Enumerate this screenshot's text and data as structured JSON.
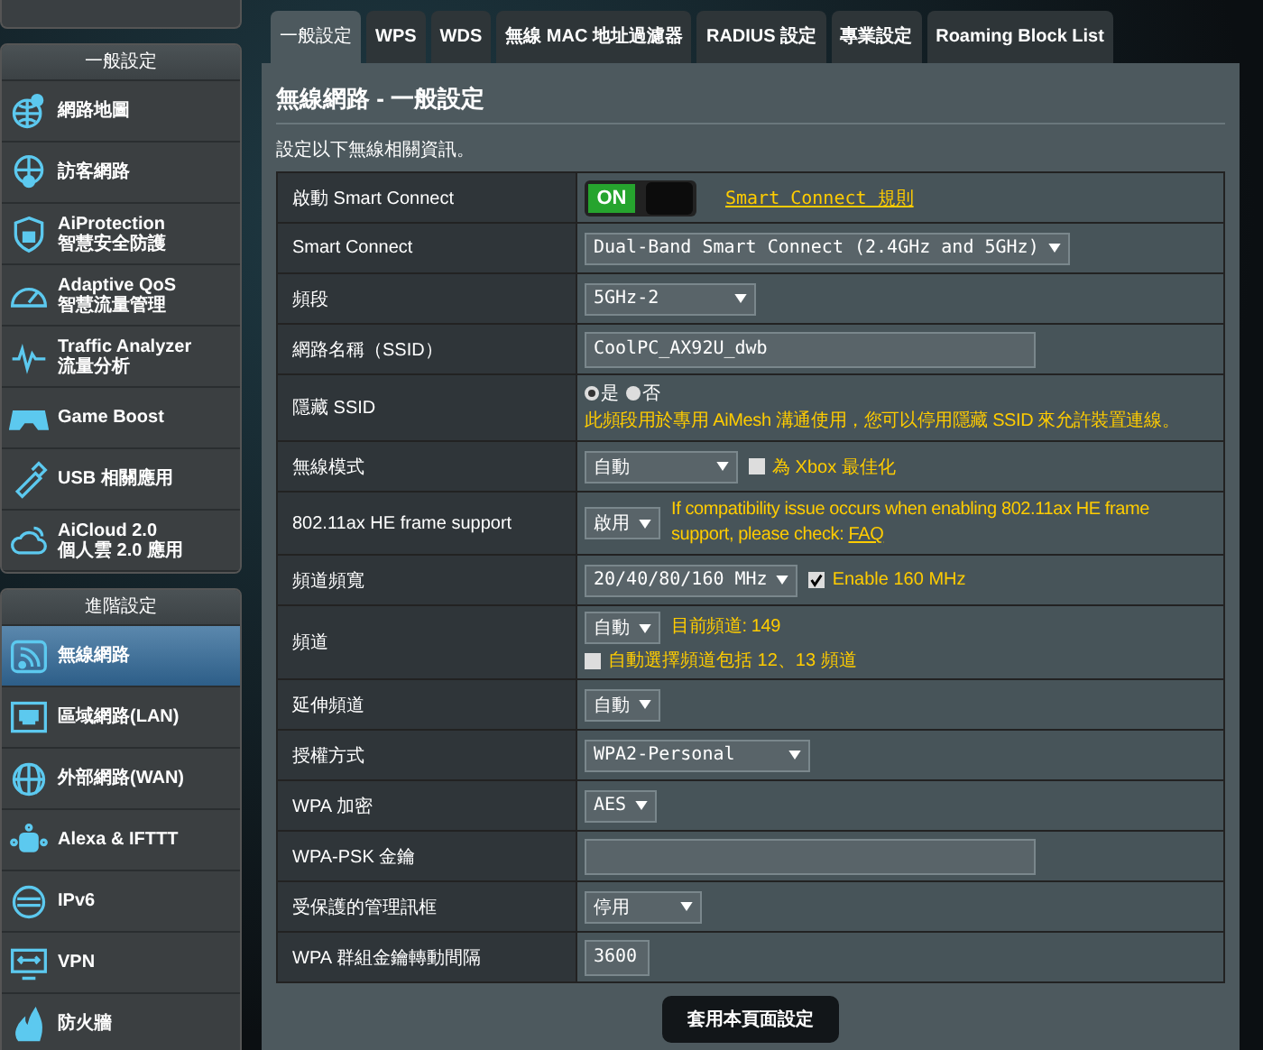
{
  "sidebar": {
    "sections": [
      {
        "title": "一般設定",
        "items": [
          {
            "label": "網路地圖",
            "selected": false
          },
          {
            "label": "訪客網路",
            "selected": false
          },
          {
            "label": "AiProtection",
            "sublabel": "智慧安全防護",
            "selected": false
          },
          {
            "label": "Adaptive QoS",
            "sublabel": "智慧流量管理",
            "selected": false
          },
          {
            "label": "Traffic Analyzer",
            "sublabel": "流量分析",
            "selected": false
          },
          {
            "label": "Game Boost",
            "selected": false
          },
          {
            "label": "USB 相關應用",
            "selected": false
          },
          {
            "label": "AiCloud 2.0",
            "sublabel": "個人雲 2.0 應用",
            "selected": false
          }
        ]
      },
      {
        "title": "進階設定",
        "items": [
          {
            "label": "無線網路",
            "selected": true
          },
          {
            "label": "區域網路(LAN)",
            "selected": false
          },
          {
            "label": "外部網路(WAN)",
            "selected": false
          },
          {
            "label": "Alexa & IFTTT",
            "selected": false
          },
          {
            "label": "IPv6",
            "selected": false
          },
          {
            "label": "VPN",
            "selected": false
          },
          {
            "label": "防火牆",
            "selected": false
          }
        ]
      }
    ]
  },
  "tabs": [
    {
      "label": "一般設定",
      "selected": true
    },
    {
      "label": "WPS",
      "selected": false
    },
    {
      "label": "WDS",
      "selected": false
    },
    {
      "label": "無線 MAC 地址過濾器",
      "selected": false
    },
    {
      "label": "RADIUS 設定",
      "selected": false
    },
    {
      "label": "專業設定",
      "selected": false
    },
    {
      "label": "Roaming Block List",
      "selected": false
    }
  ],
  "page_title": "無線網路 - 一般設定",
  "description": "設定以下無線相關資訊。",
  "rows": [
    {
      "label": "啟動 Smart Connect",
      "lines": [
        [
          {
            "kind": "toggle",
            "on": true,
            "label": "ON"
          },
          {
            "kind": "link",
            "text": "Smart Connect 規則"
          }
        ]
      ]
    },
    {
      "label": "Smart Connect",
      "lines": [
        [
          {
            "kind": "select",
            "value": "Dual-Band Smart Connect (2.4GHz and 5GHz)"
          }
        ]
      ]
    },
    {
      "label": "頻段",
      "lines": [
        [
          {
            "kind": "select",
            "value": "5GHz-2"
          }
        ]
      ]
    },
    {
      "label": "網路名稱（SSID）",
      "lines": [
        [
          {
            "kind": "input",
            "value": "CoolPC_AX92U_dwb"
          }
        ]
      ]
    },
    {
      "label": "隱藏 SSID",
      "lines": [
        [
          {
            "kind": "radio",
            "options": [
              {
                "label": "是",
                "selected": true
              },
              {
                "label": "否",
                "selected": false
              }
            ]
          }
        ],
        [
          {
            "kind": "note",
            "text": "此頻段用於專用 AiMesh 溝通使用，您可以停用隱藏 SSID 來允許裝置連線。"
          }
        ]
      ]
    },
    {
      "label": "無線模式",
      "lines": [
        [
          {
            "kind": "select",
            "value": "自動"
          },
          {
            "kind": "checkbox",
            "checked": false,
            "label": "為 Xbox 最佳化"
          }
        ]
      ]
    },
    {
      "label": "802.11ax HE frame support",
      "lines": [
        [
          {
            "kind": "select",
            "value": "啟用"
          },
          {
            "kind": "note",
            "text": "If compatibility issue occurs when enabling 802.11ax HE frame support, please check: ",
            "link": "FAQ"
          }
        ]
      ]
    },
    {
      "label": "頻道頻寬",
      "lines": [
        [
          {
            "kind": "select",
            "value": "20/40/80/160 MHz"
          },
          {
            "kind": "checkbox",
            "checked": true,
            "label": "Enable 160 MHz"
          }
        ]
      ]
    },
    {
      "label": "頻道",
      "lines": [
        [
          {
            "kind": "select",
            "value": "自動"
          },
          {
            "kind": "note",
            "text": "目前頻道: 149"
          }
        ],
        [
          {
            "kind": "checkbox",
            "checked": false,
            "label": "自動選擇頻道包括 12、13 頻道"
          }
        ]
      ]
    },
    {
      "label": "延伸頻道",
      "lines": [
        [
          {
            "kind": "select",
            "value": "自動"
          }
        ]
      ]
    },
    {
      "label": "授權方式",
      "lines": [
        [
          {
            "kind": "select",
            "value": "WPA2-Personal"
          }
        ]
      ]
    },
    {
      "label": "WPA 加密",
      "lines": [
        [
          {
            "kind": "select",
            "value": "AES"
          }
        ]
      ]
    },
    {
      "label": "WPA-PSK 金鑰",
      "lines": [
        [
          {
            "kind": "input"
          }
        ]
      ]
    },
    {
      "label": "受保護的管理訊框",
      "lines": [
        [
          {
            "kind": "select",
            "value": "停用"
          }
        ]
      ]
    },
    {
      "label": "WPA 群組金鑰轉動間隔",
      "lines": [
        [
          {
            "kind": "input",
            "value": "3600"
          }
        ]
      ]
    }
  ],
  "apply_button": "套用本頁面設定"
}
